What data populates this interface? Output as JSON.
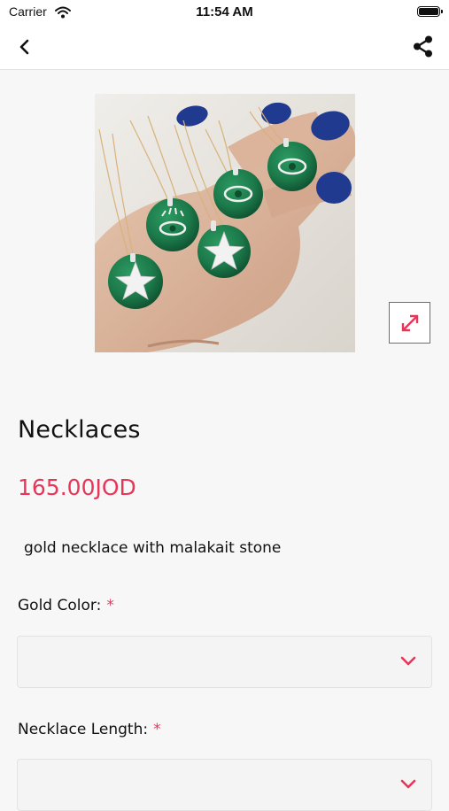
{
  "status_bar": {
    "carrier": "Carrier",
    "time": "11:54 AM"
  },
  "nav": {
    "back_icon": "chevron-left-icon",
    "share_icon": "share-icon"
  },
  "product": {
    "title": "Necklaces",
    "price": "165.00JOD",
    "description": "gold necklace with malakait stone",
    "expand_icon": "expand-arrows-icon"
  },
  "options": [
    {
      "label": "Gold Color:",
      "required_mark": "*",
      "value": ""
    },
    {
      "label": "Necklace Length:",
      "required_mark": "*",
      "value": ""
    }
  ],
  "colors": {
    "accent": "#e8365a",
    "background": "#f7f7f7",
    "malachite_green": "#1f7a4c",
    "nail_blue": "#1f3a8f"
  }
}
